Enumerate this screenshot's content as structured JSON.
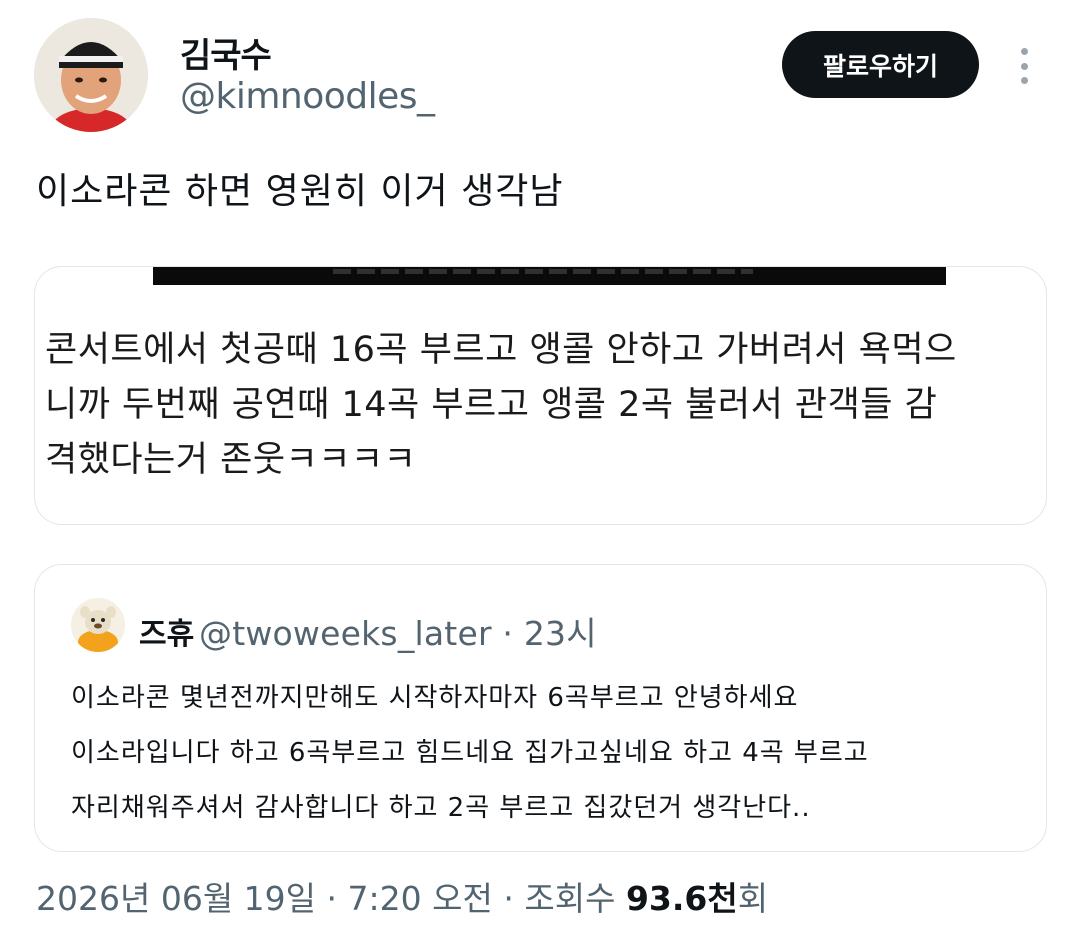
{
  "author": {
    "name": "김국수",
    "handle": "@kimnoodles_",
    "follow_label": "팔로우하기"
  },
  "tweet": {
    "text": "이소라콘 하면 영원히 이거 생각남"
  },
  "media": {
    "lines": [
      "콘서트에서 첫공때 16곡 부르고 앵콜 안하고 가버려서 욕먹으",
      "니까 두번째 공연때 14곡 부르고 앵콜 2곡 불러서 관객들 감",
      "격했다는거 존웃ㅋㅋㅋㅋ"
    ]
  },
  "quote": {
    "name": "즈휴",
    "handle": "@twoweeks_later",
    "time": "23시",
    "lines": [
      "이소라콘 몇년전까지만해도 시작하자마자 6곡부르고 안녕하세요",
      "이소라입니다 하고 6곡부르고 힘드네요 집가고싶네요 하고 4곡 부르고",
      "자리채워주셔서 감사합니다 하고 2곡 부르고 집갔던거 생각난다.."
    ]
  },
  "meta": {
    "date": "2026년 06월 19일",
    "time": "7:20 오전",
    "views_label": "조회수",
    "views_count": "93.6천",
    "views_suffix": "회",
    "separator": "·"
  },
  "icons": {
    "more": "more-vertical-icon"
  }
}
